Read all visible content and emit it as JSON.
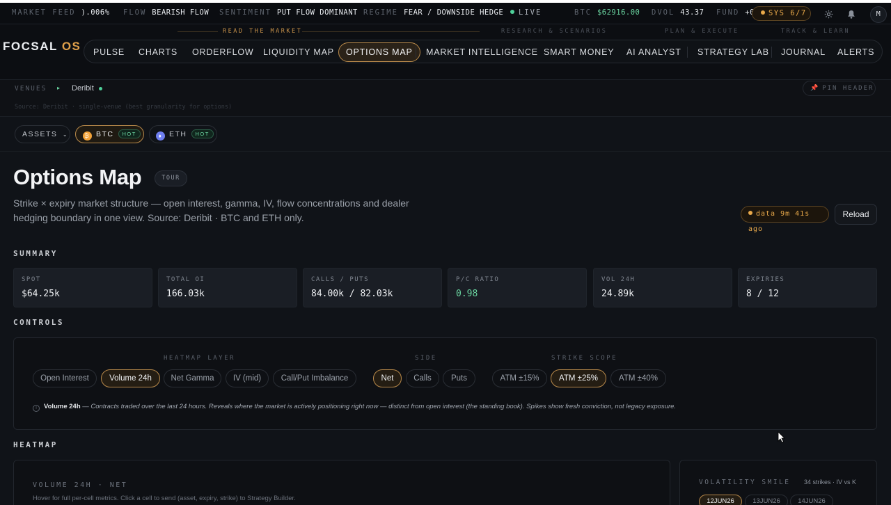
{
  "ticker": {
    "market_feed_label": "MARKET FEED",
    "market_feed_value": ").006%",
    "flow_label": "FLOW",
    "flow_value": "BEARISH FLOW",
    "sentiment_label": "SENTIMENT",
    "sentiment_value": "PUT FLOW DOMINANT",
    "regime_label": "REGIME",
    "regime_value": "FEAR / DOWNSIDE HEDGE",
    "live": "LIVE",
    "btc_label": "BTC",
    "btc_value": "$62916.00",
    "dvol_label": "DVOL",
    "dvol_value": "43.37",
    "fund_label": "FUND",
    "fund_value": "+0",
    "sys": "SYS 6/7",
    "avatar": "M"
  },
  "header": {
    "logo_main": "FOCSAL",
    "logo_suffix": "OS",
    "groups": [
      "READ THE MARKET",
      "RESEARCH & SCENARIOS",
      "PLAN & EXECUTE",
      "TRACK & LEARN"
    ],
    "nav": [
      "PULSE",
      "CHARTS",
      "ORDERFLOW",
      "LIQUIDITY MAP",
      "OPTIONS MAP",
      "MARKET INTELLIGENCE",
      "SMART MONEY",
      "AI ANALYST",
      "STRATEGY LAB",
      "JOURNAL",
      "ALERTS"
    ],
    "active_nav": "OPTIONS MAP"
  },
  "venues": {
    "label": "VENUES",
    "name": "Deribit",
    "source": "Source: Deribit · single-venue (best granularity for options)",
    "pin": "PIN HEADER"
  },
  "assets": {
    "label": "ASSETS",
    "items": [
      {
        "name": "BTC",
        "badge": "HOT",
        "symbol": "₿",
        "color": "#f2a33a"
      },
      {
        "name": "ETH",
        "badge": "HOT",
        "symbol": "♦",
        "color": "#6f7ff0"
      }
    ],
    "active": "BTC"
  },
  "page": {
    "title": "Options Map",
    "tour": "TOUR",
    "subtitle": "Strike × expiry market structure — open interest, gamma, IV, flow concentrations and dealer hedging boundary in one view. Source: Deribit · BTC and ETH only.",
    "data_age": "data 9m 41s ago",
    "reload": "Reload"
  },
  "summary": {
    "heading": "SUMMARY",
    "cards": [
      {
        "label": "SPOT",
        "value": "$64.25k"
      },
      {
        "label": "TOTAL OI",
        "value": "166.03k"
      },
      {
        "label": "CALLS / PUTS",
        "value": "84.00k / 82.03k"
      },
      {
        "label": "P/C RATIO",
        "value": "0.98"
      },
      {
        "label": "VOL 24H",
        "value": "24.89k"
      },
      {
        "label": "EXPIRIES",
        "value": "8 / 12"
      }
    ]
  },
  "controls": {
    "heading": "CONTROLS",
    "layer_label": "HEATMAP LAYER",
    "layers": [
      "Open Interest",
      "Volume 24h",
      "Net Gamma",
      "IV (mid)",
      "Call/Put Imbalance"
    ],
    "active_layer": "Volume 24h",
    "side_label": "SIDE",
    "sides": [
      "Net",
      "Calls",
      "Puts"
    ],
    "active_side": "Net",
    "scope_label": "STRIKE SCOPE",
    "scopes": [
      "ATM ±15%",
      "ATM ±25%",
      "ATM ±40%"
    ],
    "active_scope": "ATM ±25%",
    "hint_title": "Volume 24h",
    "hint_text": " — Contracts traded over the last 24 hours. Reveals where the market is actively positioning right now — distinct from open interest (the standing book). Spikes show fresh conviction, not legacy exposure."
  },
  "heatmap": {
    "heading": "HEATMAP",
    "panel_title": "VOLUME 24H · NET",
    "panel_hint": "Hover for full per-cell metrics. Click a cell to send (asset, expiry, strike) to Strategy Builder.",
    "smile_title": "VOLATILITY SMILE",
    "smile_meta": "34 strikes · IV vs K",
    "expiries": [
      "12JUN26",
      "13JUN26",
      "14JUN26"
    ],
    "active_expiry": "12JUN26"
  },
  "colors": {
    "accent": "#e0a04a",
    "positive": "#6ad4a0",
    "background": "#101318"
  }
}
